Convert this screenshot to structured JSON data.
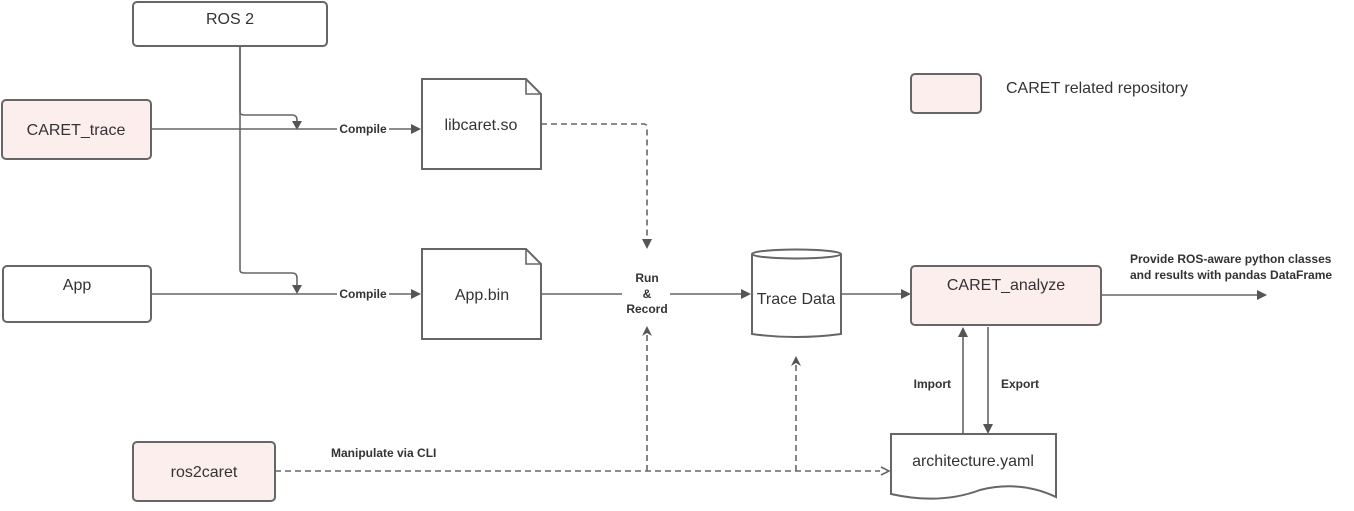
{
  "nodes": {
    "ros2": {
      "label": "ROS 2"
    },
    "caret_trace": {
      "label": "CARET_trace"
    },
    "app": {
      "label": "App"
    },
    "libcaret": {
      "label": "libcaret.so"
    },
    "app_bin": {
      "label": "App.bin"
    },
    "trace_data": {
      "label": "Trace Data"
    },
    "caret_analyze": {
      "label": "CARET_analyze"
    },
    "ros2caret": {
      "label": "ros2caret"
    },
    "architecture_yaml": {
      "label": "architecture.yaml"
    }
  },
  "edges": {
    "compile_top": "Compile",
    "compile_bottom": "Compile",
    "run_record": [
      "Run",
      "&",
      "Record"
    ],
    "manipulate": "Manipulate via CLI",
    "import": "Import",
    "export": "Export",
    "provide": [
      "Provide ROS-aware python classes",
      "and results with pandas DataFrame"
    ]
  },
  "legend": {
    "label": "CARET related repository",
    "swatch_color": "#fdeeee"
  },
  "colors": {
    "caret_fill": "#fdeeee",
    "stroke": "#666666",
    "text": "#333333"
  }
}
